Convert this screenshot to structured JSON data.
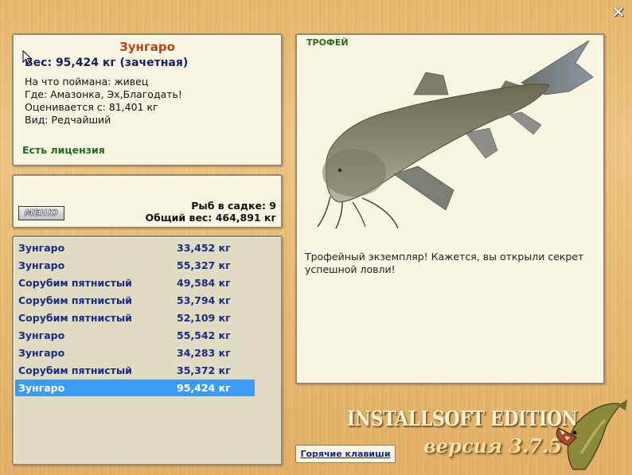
{
  "window": {
    "close_icon": "close-icon"
  },
  "info": {
    "fish_name": "Зунгаро",
    "weight_line": "Вес: 95,424 кг (зачетная)",
    "bait_line": "На что поймана: живец",
    "place_line": "Где: Амазонка, Эх,Благодать!",
    "value_line": "Оценивается с: 81,401 кг",
    "kind_line": "Вид: Редчайший",
    "license": "Есть лицензия"
  },
  "keepnet": {
    "menu_label": "МЕНЮ",
    "count_line": "Рыб в садке: 9",
    "total_line": "Общий вес: 464,891 кг"
  },
  "catch_list": [
    {
      "name": "Зунгаро",
      "weight": "33,452 кг"
    },
    {
      "name": "Зунгаро",
      "weight": "55,327 кг"
    },
    {
      "name": "Сорубим пятнистый",
      "weight": "49,584 кг"
    },
    {
      "name": "Сорубим пятнистый",
      "weight": "53,794 кг"
    },
    {
      "name": "Сорубим пятнистый",
      "weight": "52,109 кг"
    },
    {
      "name": "Зунгаро",
      "weight": "55,542 кг"
    },
    {
      "name": "Зунгаро",
      "weight": "34,283 кг"
    },
    {
      "name": "Сорубим пятнистый",
      "weight": "35,372 кг"
    },
    {
      "name": "Зунгаро",
      "weight": "95,424 кг",
      "selected": true
    }
  ],
  "trophy": {
    "label": "ТРОФЕЙ",
    "description": "Трофейный экземпляр! Кажется, вы открыли секрет успешной ловли!"
  },
  "footer": {
    "hotkeys_label": "Горячие клавиши",
    "edition": "INSTALLSOFT EDITION",
    "version": "версия 3.7.5"
  },
  "colors": {
    "selection": "#3c9cf5",
    "list_text": "#1a2a85",
    "fish_title": "#b74416",
    "license": "#1d6f1f",
    "trophy_label": "#2c6b1f"
  }
}
